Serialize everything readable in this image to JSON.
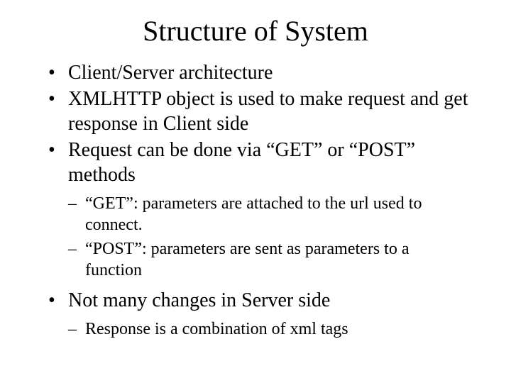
{
  "title": "Structure of System",
  "bullets": {
    "b0": "Client/Server architecture",
    "b1": "XMLHTTP object is used to make request and get response in Client side",
    "b2": "Request can be done via “GET” or “POST” methods",
    "b2_subs": {
      "s0": "“GET”: parameters are attached to the url used to connect.",
      "s1": "“POST”: parameters are sent as parameters to a function"
    },
    "b3": "Not many changes in Server side",
    "b3_subs": {
      "s0": "Response is a combination of xml tags"
    }
  }
}
